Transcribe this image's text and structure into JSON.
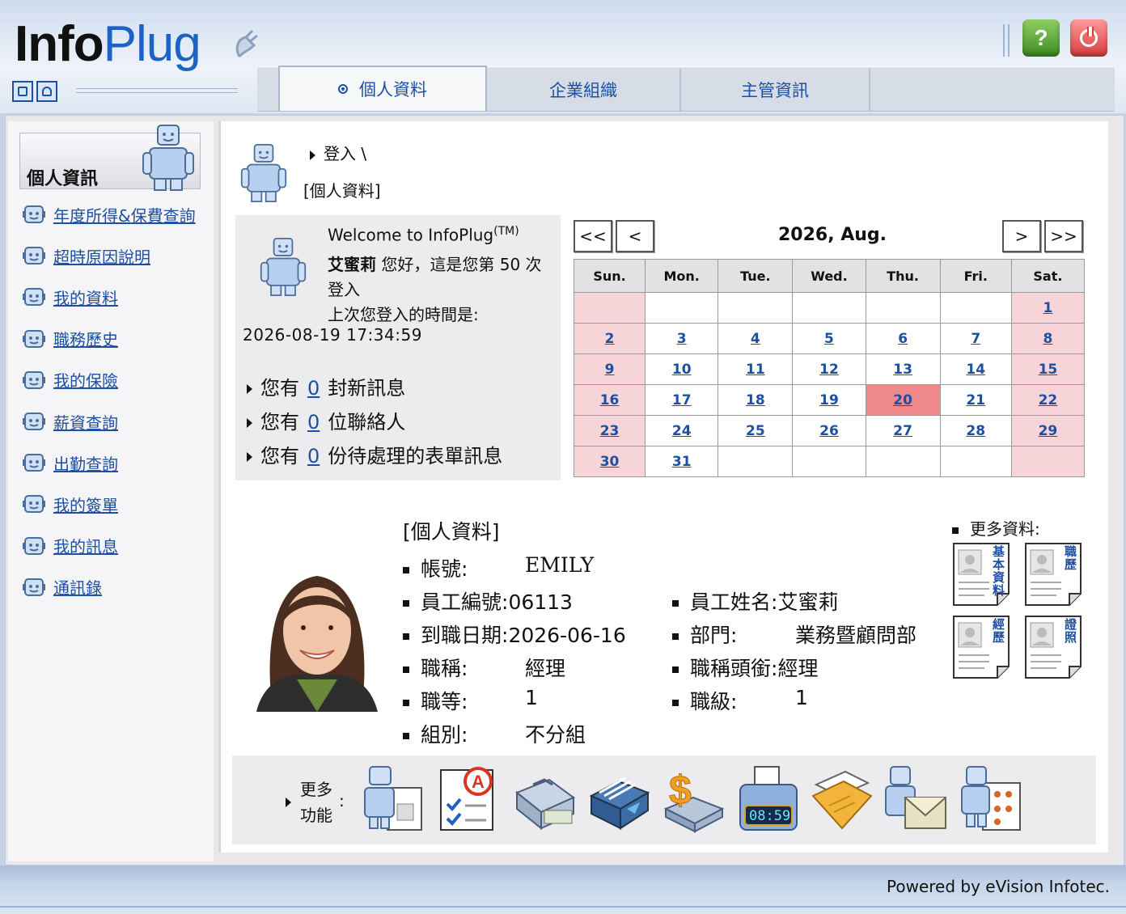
{
  "header": {
    "logo_info": "Info",
    "logo_plug": "Plug",
    "help_label": "?",
    "tabs": [
      {
        "label": "個人資料",
        "active": true
      },
      {
        "label": "企業組織",
        "active": false
      },
      {
        "label": "主管資訊",
        "active": false
      }
    ]
  },
  "sidebar": {
    "title": "個人資訊",
    "items": [
      {
        "label": "年度所得&保費查詢"
      },
      {
        "label": "超時原因說明"
      },
      {
        "label": "我的資料"
      },
      {
        "label": "職務歷史"
      },
      {
        "label": "我的保險"
      },
      {
        "label": "薪資查詢"
      },
      {
        "label": "出勤查詢"
      },
      {
        "label": "我的簽單"
      },
      {
        "label": "我的訊息"
      },
      {
        "label": "通訊錄"
      }
    ]
  },
  "breadcrumb": {
    "line1": "登入 \\",
    "line2": "[個人資料]"
  },
  "welcome": {
    "greeting": "Welcome to InfoPlug",
    "tm": "(TM)",
    "user_name": "艾蜜莉",
    "hello_text": " 您好，這是您第 50 次登入",
    "last_login_label": "上次您登入的時間是:",
    "last_login_time": "2026-08-19 17:34:59",
    "messages": [
      {
        "prefix": "您有",
        "count": "0",
        "suffix": "封新訊息"
      },
      {
        "prefix": "您有",
        "count": "0",
        "suffix": "位聯絡人"
      },
      {
        "prefix": "您有",
        "count": "0",
        "suffix": "份待處理的表單訊息"
      }
    ]
  },
  "calendar": {
    "title": "2026, Aug.",
    "nav": {
      "prev_year": "<<",
      "prev_month": "<",
      "next_month": ">",
      "next_year": ">>"
    },
    "weekdays": [
      "Sun.",
      "Mon.",
      "Tue.",
      "Wed.",
      "Thu.",
      "Fri.",
      "Sat."
    ],
    "weeks": [
      [
        "",
        "",
        "",
        "",
        "",
        "",
        "1"
      ],
      [
        "2",
        "3",
        "4",
        "5",
        "6",
        "7",
        "8"
      ],
      [
        "9",
        "10",
        "11",
        "12",
        "13",
        "14",
        "15"
      ],
      [
        "16",
        "17",
        "18",
        "19",
        "20",
        "21",
        "22"
      ],
      [
        "23",
        "24",
        "25",
        "26",
        "27",
        "28",
        "29"
      ],
      [
        "30",
        "31",
        "",
        "",
        "",
        "",
        ""
      ]
    ],
    "today": "20",
    "colors": {
      "weekend": "#f7d4d8",
      "today": "#f08a8a"
    }
  },
  "profile": {
    "title": "[個人資料]",
    "fields_left": [
      {
        "label": "帳號:",
        "value": "EMILY"
      },
      {
        "label": "員工編號:",
        "value": "06113"
      },
      {
        "label": "到職日期:",
        "value": "2026-06-16"
      },
      {
        "label": "職稱:",
        "value": "經理"
      },
      {
        "label": "職等:",
        "value": "1"
      },
      {
        "label": "組別:",
        "value": "不分組"
      }
    ],
    "fields_right": [
      {
        "label": "員工姓名:",
        "value": "艾蜜莉"
      },
      {
        "label": "部門:",
        "value": "業務暨顧問部"
      },
      {
        "label": "職稱頭銜:",
        "value": "經理"
      },
      {
        "label": "職級:",
        "value": "1"
      }
    ],
    "more_label": "更多資料:",
    "docs": [
      {
        "label": "基本資料"
      },
      {
        "label": "職歷"
      },
      {
        "label": "經歷"
      },
      {
        "label": "證照"
      }
    ]
  },
  "functions": {
    "label_line1": "更多",
    "label_line2": "功能",
    "colon": ":",
    "clock_text": "08:59",
    "icons": [
      "contact-card-icon",
      "checklist-icon",
      "briefcase-money-icon",
      "file-box-icon",
      "money-tray-icon",
      "time-clock-icon",
      "folder-icon",
      "mail-icon",
      "org-chart-icon"
    ]
  },
  "footer": {
    "text": "Powered by eVision Infotec."
  },
  "colors": {
    "accent": "#1d4fa3",
    "logo_blue": "#1d63c6"
  }
}
